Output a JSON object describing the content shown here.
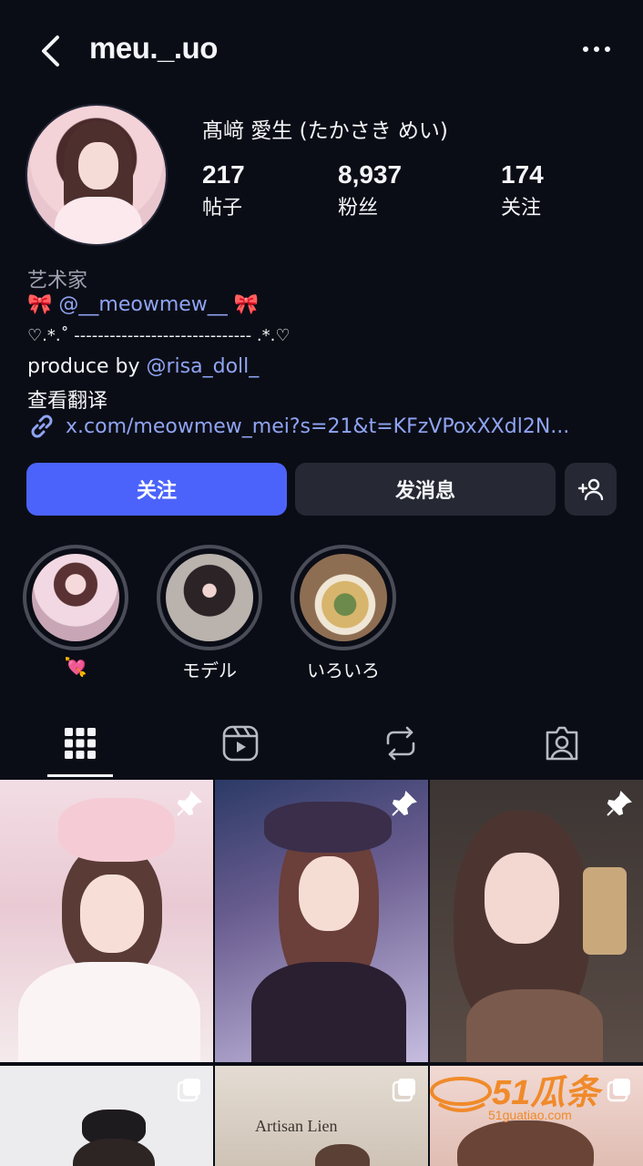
{
  "header": {
    "username": "meu._.uo",
    "back_icon": "chevron-left-icon",
    "more_icon": "ellipsis-icon"
  },
  "profile": {
    "display_name": "髙﨑 愛生 (たかさき めい)",
    "stats": {
      "posts": {
        "value": "217",
        "label": "帖子"
      },
      "followers": {
        "value": "8,937",
        "label": "粉丝"
      },
      "following": {
        "value": "174",
        "label": "关注"
      }
    }
  },
  "bio": {
    "category": "艺术家",
    "line1_emoji_left": "🎀",
    "line1_handle": "@__meowmew__",
    "line1_emoji_right": "🎀",
    "line2": "♡.*.˚ ------------------------------ .*.♡",
    "line3_prefix": "produce by ",
    "line3_handle": "@risa_doll_",
    "translate": "查看翻译",
    "url": "x.com/meowmew_mei?s=21&t=KFzVPoxXXdl2N..."
  },
  "actions": {
    "follow": "关注",
    "message": "发消息",
    "suggest_icon": "add-person-icon"
  },
  "highlights": [
    {
      "label": "💘"
    },
    {
      "label": "モデル"
    },
    {
      "label": "いろいろ"
    }
  ],
  "tabs": [
    {
      "icon": "grid-icon",
      "active": true
    },
    {
      "icon": "reels-icon",
      "active": false
    },
    {
      "icon": "reposts-icon",
      "active": false
    },
    {
      "icon": "tagged-icon",
      "active": false
    }
  ],
  "posts": [
    {
      "pinned": true
    },
    {
      "pinned": true
    },
    {
      "pinned": true
    },
    {
      "multi": true
    },
    {
      "multi": true,
      "caption": "Artisan Lien"
    },
    {
      "multi": true
    }
  ],
  "watermark": {
    "brand": "51瓜条",
    "site": "51guatiao.com"
  },
  "colors": {
    "background": "#0b0d16",
    "follow_button": "#4c63fb",
    "secondary_button": "#262833",
    "link": "#8fa4f3",
    "muted_text": "#9ea2b0"
  }
}
